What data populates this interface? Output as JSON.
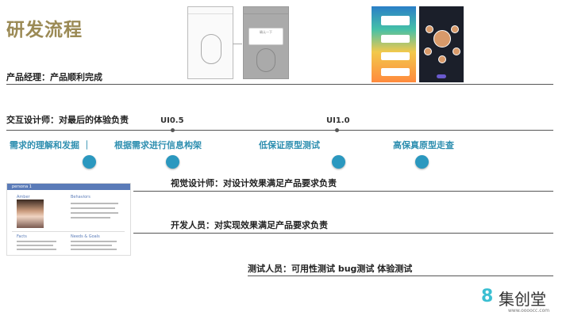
{
  "page": {
    "title": "研发流程"
  },
  "roles": {
    "product_manager": "产品经理：产品顺利完成",
    "interaction_designer": "交互设计师：对最后的体验负责",
    "visual_designer": "视觉设计师：对设计效果满足产品要求负责",
    "developer": "开发人员：对实现效果满足产品要求负责",
    "tester": "测试人员：可用性测试  bug测试  体验测试"
  },
  "versions": {
    "v05": "UI0.5",
    "v10": "UI1.0"
  },
  "phases": [
    "需求的理解和发掘 ｜",
    "根据需求进行信息构架",
    "低保证原型测试",
    "高保真原型走查"
  ],
  "persona": {
    "header": "persona 1",
    "name": "Amber",
    "behaviors": "Behaviors",
    "facts": "Facts",
    "needs": "Needs & Goals"
  },
  "mockup": {
    "dialog_title": "确认一下"
  },
  "logo": {
    "text": "集创堂",
    "url": "www.oooocc.com"
  }
}
